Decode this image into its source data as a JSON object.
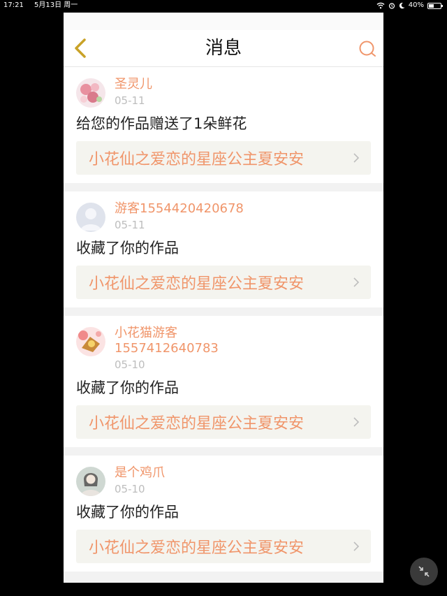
{
  "status": {
    "time": "17:21",
    "date": "5月13日 周一",
    "battery": "40%"
  },
  "nav": {
    "title": "消息",
    "back_icon": "chevron-left-icon",
    "search_icon": "search-icon"
  },
  "colors": {
    "accent": "#f0956a",
    "back": "#c9a227"
  },
  "messages": [
    {
      "name": "圣灵儿",
      "date": "05-11",
      "text": "给您的作品赠送了1朵鲜花",
      "work": "小花仙之爱恋的星座公主夏安安",
      "avatar": "flowers"
    },
    {
      "name": "游客1554420420678",
      "date": "05-11",
      "text": "收藏了你的作品",
      "work": "小花仙之爱恋的星座公主夏安安",
      "avatar": "default"
    },
    {
      "name": "小花猫游客\n1557412640783",
      "date": "05-10",
      "text": "收藏了你的作品",
      "work": "小花仙之爱恋的星座公主夏安安",
      "avatar": "cartoon"
    },
    {
      "name": "是个鸡爪",
      "date": "05-10",
      "text": "收藏了你的作品",
      "work": "小花仙之爱恋的星座公主夏安安",
      "avatar": "photo"
    }
  ]
}
